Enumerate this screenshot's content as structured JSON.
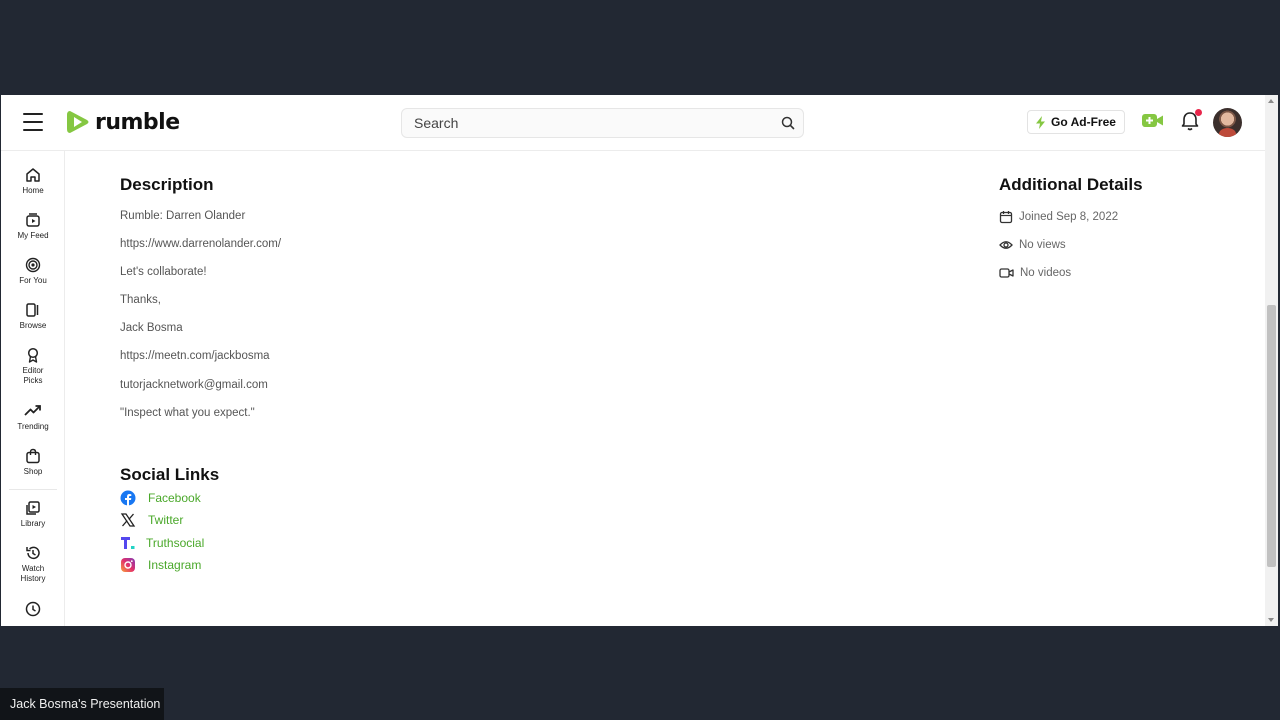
{
  "header": {
    "logo_text": "rumble",
    "search_placeholder": "Search",
    "adfree_label": "Go Ad-Free"
  },
  "sidebar": {
    "items": [
      {
        "label": "Home",
        "icon": "home-icon"
      },
      {
        "label": "My Feed",
        "icon": "feed-icon"
      },
      {
        "label": "For You",
        "icon": "target-icon"
      },
      {
        "label": "Browse",
        "icon": "browse-icon"
      },
      {
        "label": "Editor Picks",
        "icon": "award-icon"
      },
      {
        "label": "Trending",
        "icon": "trending-icon"
      },
      {
        "label": "Shop",
        "icon": "bag-icon"
      },
      {
        "label": "Library",
        "icon": "library-icon"
      },
      {
        "label": "Watch History",
        "icon": "history-icon"
      },
      {
        "label": "",
        "icon": "clock-icon"
      }
    ]
  },
  "description": {
    "heading": "Description",
    "lines": [
      "Rumble: Darren Olander",
      "https://www.darrenolander.com/",
      "Let's collaborate!",
      "Thanks,",
      "Jack Bosma",
      "https://meetn.com/jackbosma",
      "tutorjacknetwork@gmail.com",
      "\"Inspect what you expect.\""
    ]
  },
  "social": {
    "heading": "Social Links",
    "links": [
      {
        "label": "Facebook",
        "icon": "facebook-icon"
      },
      {
        "label": "Twitter",
        "icon": "x-icon"
      },
      {
        "label": "Truthsocial",
        "icon": "truthsocial-icon"
      },
      {
        "label": "Instagram",
        "icon": "instagram-icon"
      }
    ]
  },
  "details": {
    "heading": "Additional Details",
    "items": [
      {
        "label": "Joined Sep 8, 2022",
        "icon": "calendar-icon"
      },
      {
        "label": "No views",
        "icon": "eye-icon"
      },
      {
        "label": "No videos",
        "icon": "video-icon"
      }
    ]
  },
  "presenter_label": "Jack Bosma's Presentation",
  "colors": {
    "brand_green": "#85c742",
    "link_green": "#4aa82a",
    "backdrop": "#222833"
  }
}
